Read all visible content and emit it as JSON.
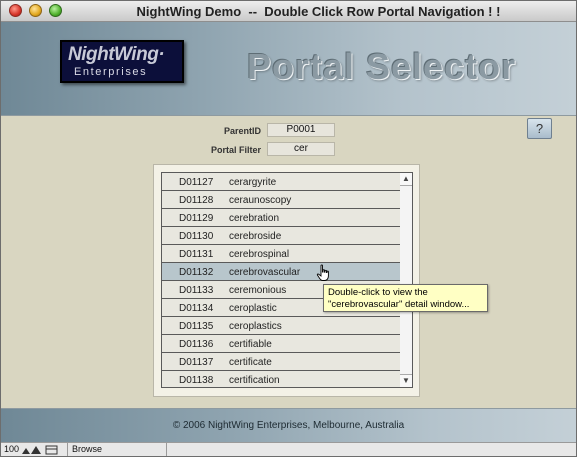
{
  "window": {
    "title": "NightWing Demo  --  Double Click Row Portal Navigation ! !"
  },
  "header": {
    "logo_top": "NightWing·",
    "logo_sub": "Enterprises",
    "page_title": "Portal Selector",
    "help_label": "?"
  },
  "fields": {
    "parent_id_label": "ParentID",
    "parent_id_value": "P0001",
    "portal_filter_label": "Portal Filter",
    "portal_filter_value": "cer"
  },
  "portal": {
    "rows": [
      {
        "id": "D01127",
        "name": "cerargyrite"
      },
      {
        "id": "D01128",
        "name": "ceraunoscopy"
      },
      {
        "id": "D01129",
        "name": "cerebration"
      },
      {
        "id": "D01130",
        "name": "cerebroside"
      },
      {
        "id": "D01131",
        "name": "cerebrospinal"
      },
      {
        "id": "D01132",
        "name": "cerebrovascular"
      },
      {
        "id": "D01133",
        "name": "ceremonious"
      },
      {
        "id": "D01134",
        "name": "ceroplastic"
      },
      {
        "id": "D01135",
        "name": "ceroplastics"
      },
      {
        "id": "D01136",
        "name": "certifiable"
      },
      {
        "id": "D01137",
        "name": "certificate"
      },
      {
        "id": "D01138",
        "name": "certification"
      }
    ],
    "hover_index": 5
  },
  "tooltip": {
    "line1": "Double-click to view the",
    "line2": "\"cerebrovascular\" detail window..."
  },
  "footer": {
    "copyright": "©  2006  NightWing Enterprises, Melbourne, Australia"
  },
  "status": {
    "zoom": "100",
    "mode": "Browse"
  },
  "colors": {
    "row_bg": "#e8e7df",
    "row_hover_bg": "#b8c6cc",
    "tooltip_bg": "#ffffc4",
    "window_bg": "#d9d6c1"
  },
  "icons": [
    "close-icon",
    "minimize-icon",
    "zoom-icon",
    "hand-cursor-icon",
    "scroll-up-icon",
    "scroll-down-icon"
  ]
}
